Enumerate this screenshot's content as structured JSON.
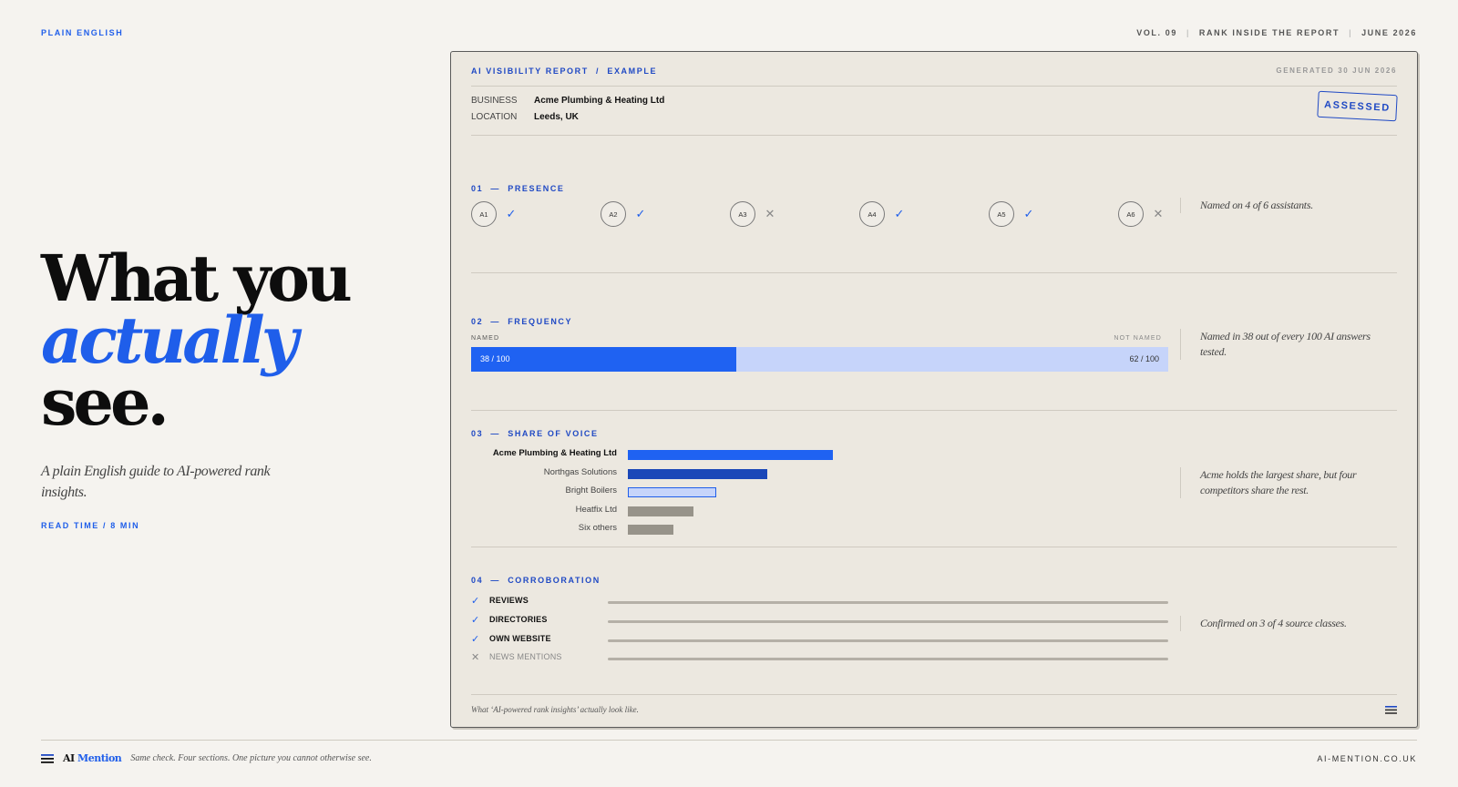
{
  "header": {
    "brand": "PLAIN ENGLISH",
    "meta": [
      "VOL. 09",
      "RANK INSIDE THE REPORT",
      "JUNE 2026"
    ]
  },
  "hero": {
    "line1": "What you",
    "line2": "actually",
    "line3": "see.",
    "subtitle": "A plain English guide to AI-powered rank insights.",
    "read_time": "READ TIME / 8 MIN"
  },
  "report": {
    "title": "AI VISIBILITY REPORT  /  EXAMPLE",
    "generated": "GENERATED 30 JUN 2026",
    "business_label": "BUSINESS",
    "business_value": "Acme Plumbing & Heating Ltd",
    "location_label": "LOCATION",
    "location_value": "Leeds, UK",
    "stamp": "ASSESSED",
    "presence": {
      "label": "01  —  PRESENCE",
      "assistants": [
        {
          "id": "A1",
          "named": true
        },
        {
          "id": "A2",
          "named": true
        },
        {
          "id": "A3",
          "named": false
        },
        {
          "id": "A4",
          "named": true
        },
        {
          "id": "A5",
          "named": true
        },
        {
          "id": "A6",
          "named": false
        }
      ],
      "check_glyph": "✓",
      "cross_glyph": "✕",
      "note": "Named on 4 of 6 assistants."
    },
    "frequency": {
      "label": "02  —  FREQUENCY",
      "named_label": "NAMED",
      "not_named_label": "NOT NAMED",
      "named": 38,
      "total": 100,
      "named_text": "38 / 100",
      "not_named_text": "62 / 100",
      "note": "Named in 38 out of every 100 AI answers tested."
    },
    "share_of_voice": {
      "label": "03  —  SHARE OF VOICE",
      "rows": [
        {
          "name": "Acme Plumbing & Heating Ltd",
          "share": 1.0,
          "color": "#1f62f2",
          "primary": true
        },
        {
          "name": "Northgas Solutions",
          "share": 0.68,
          "color": "#1a47b8",
          "primary": false
        },
        {
          "name": "Bright Boilers",
          "share": 0.43,
          "color": "#c6d4fa",
          "primary": false
        },
        {
          "name": "Heatfix Ltd",
          "share": 0.32,
          "color": "#97938a",
          "primary": false
        },
        {
          "name": "Six others",
          "share": 0.22,
          "color": "#97938a",
          "primary": false
        }
      ],
      "note": "Acme holds the largest share, but four competitors share the rest."
    },
    "corroboration": {
      "label": "04  —  CORROBORATION",
      "rows": [
        {
          "label": "REVIEWS",
          "confirmed": true
        },
        {
          "label": "DIRECTORIES",
          "confirmed": true
        },
        {
          "label": "OWN WEBSITE",
          "confirmed": true
        },
        {
          "label": "NEWS MENTIONS",
          "confirmed": false
        }
      ],
      "note": "Confirmed on 3 of 4 source classes."
    },
    "footer": "What ‘AI-powered rank insights’ actually look like."
  },
  "footer": {
    "logo_a": "AI",
    "logo_b": "Mention",
    "tagline": "Same check. Four sections. One picture you cannot otherwise see.",
    "url": "AI-MENTION.CO.UK"
  },
  "colors": {
    "accent": "#1f5eea",
    "accent_dark": "#1f49c4",
    "background": "#f5f3ef",
    "card": "#ece8e0"
  }
}
